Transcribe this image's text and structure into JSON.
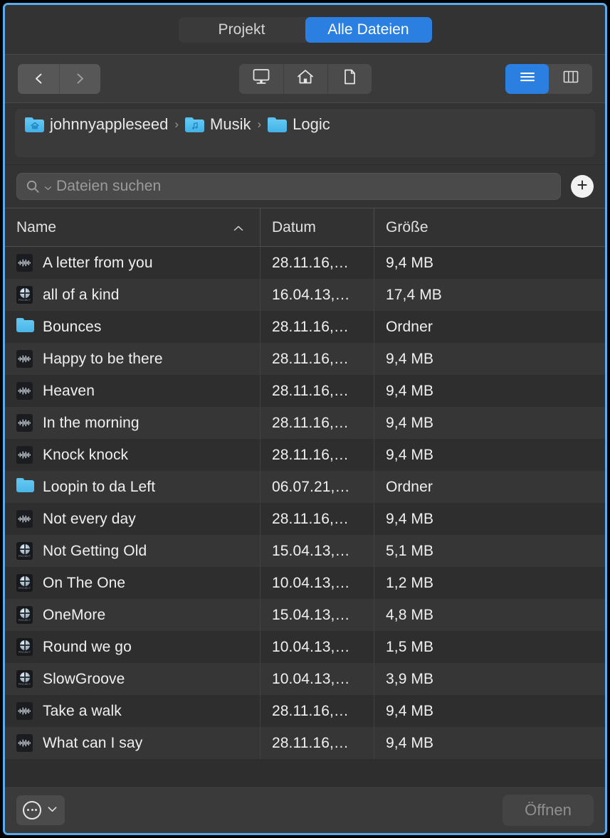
{
  "header": {
    "tabs": [
      {
        "label": "Projekt",
        "active": false
      },
      {
        "label": "Alle Dateien",
        "active": true
      }
    ]
  },
  "toolbar": {
    "back_icon": "chevron-left-icon",
    "forward_icon": "chevron-right-icon",
    "places": [
      {
        "name": "computer-icon"
      },
      {
        "name": "home-icon"
      },
      {
        "name": "document-icon"
      }
    ],
    "views": [
      {
        "name": "list-view-icon",
        "active": true
      },
      {
        "name": "column-view-icon",
        "active": false
      }
    ]
  },
  "pathbar": {
    "crumbs": [
      {
        "label": "johnnyappleseed",
        "icon": "home-folder-icon"
      },
      {
        "label": "Musik",
        "icon": "music-folder-icon"
      },
      {
        "label": "Logic",
        "icon": "folder-icon"
      }
    ],
    "separator": "›"
  },
  "search": {
    "placeholder": "Dateien suchen",
    "value": "",
    "icon": "search-icon",
    "caret_icon": "chevron-down-icon",
    "add_icon": "plus-icon"
  },
  "table": {
    "columns": [
      {
        "key": "name",
        "label": "Name",
        "sorted": true,
        "sort_icon": "chevron-up-icon"
      },
      {
        "key": "date",
        "label": "Datum"
      },
      {
        "key": "size",
        "label": "Größe"
      }
    ],
    "rows": [
      {
        "icon": "audio-file-icon",
        "name": "A letter from you",
        "date": "28.11.16,…",
        "size": "9,4 MB"
      },
      {
        "icon": "project-file-icon",
        "name": "all of a kind",
        "date": "16.04.13,…",
        "size": "17,4 MB"
      },
      {
        "icon": "folder-icon",
        "name": "Bounces",
        "date": "28.11.16,…",
        "size": "Ordner"
      },
      {
        "icon": "audio-file-icon",
        "name": "Happy to be there",
        "date": "28.11.16,…",
        "size": "9,4 MB"
      },
      {
        "icon": "audio-file-icon",
        "name": "Heaven",
        "date": "28.11.16,…",
        "size": "9,4 MB"
      },
      {
        "icon": "audio-file-icon",
        "name": "In the morning",
        "date": "28.11.16,…",
        "size": "9,4 MB"
      },
      {
        "icon": "audio-file-icon",
        "name": "Knock knock",
        "date": "28.11.16,…",
        "size": "9,4 MB"
      },
      {
        "icon": "folder-icon",
        "name": "Loopin to da Left",
        "date": "06.07.21,…",
        "size": "Ordner"
      },
      {
        "icon": "audio-file-icon",
        "name": "Not every day",
        "date": "28.11.16,…",
        "size": "9,4 MB"
      },
      {
        "icon": "project-file-icon",
        "name": "Not Getting Old",
        "date": "15.04.13,…",
        "size": "5,1 MB"
      },
      {
        "icon": "project-file-icon",
        "name": "On The One",
        "date": "10.04.13,…",
        "size": "1,2 MB"
      },
      {
        "icon": "project-file-icon",
        "name": "OneMore",
        "date": "15.04.13,…",
        "size": "4,8 MB"
      },
      {
        "icon": "project-file-icon",
        "name": "Round we go",
        "date": "10.04.13,…",
        "size": "1,5 MB"
      },
      {
        "icon": "project-file-icon",
        "name": "SlowGroove",
        "date": "10.04.13,…",
        "size": "3,9 MB"
      },
      {
        "icon": "audio-file-icon",
        "name": "Take a walk",
        "date": "28.11.16,…",
        "size": "9,4 MB"
      },
      {
        "icon": "audio-file-icon",
        "name": "What can I say",
        "date": "28.11.16,…",
        "size": "9,4 MB"
      }
    ]
  },
  "bottombar": {
    "action_icon": "ellipsis-circle-icon",
    "action_caret_icon": "chevron-down-icon",
    "open_label": "Öffnen"
  },
  "project_icon_label": "PROJECT",
  "colors": {
    "accent": "#2a7fe0",
    "window_border": "#5aaaec",
    "folder_blue": "#55c0ef",
    "bg": "#323232",
    "row_odd": "#2e2e2e",
    "row_even": "#363636"
  }
}
